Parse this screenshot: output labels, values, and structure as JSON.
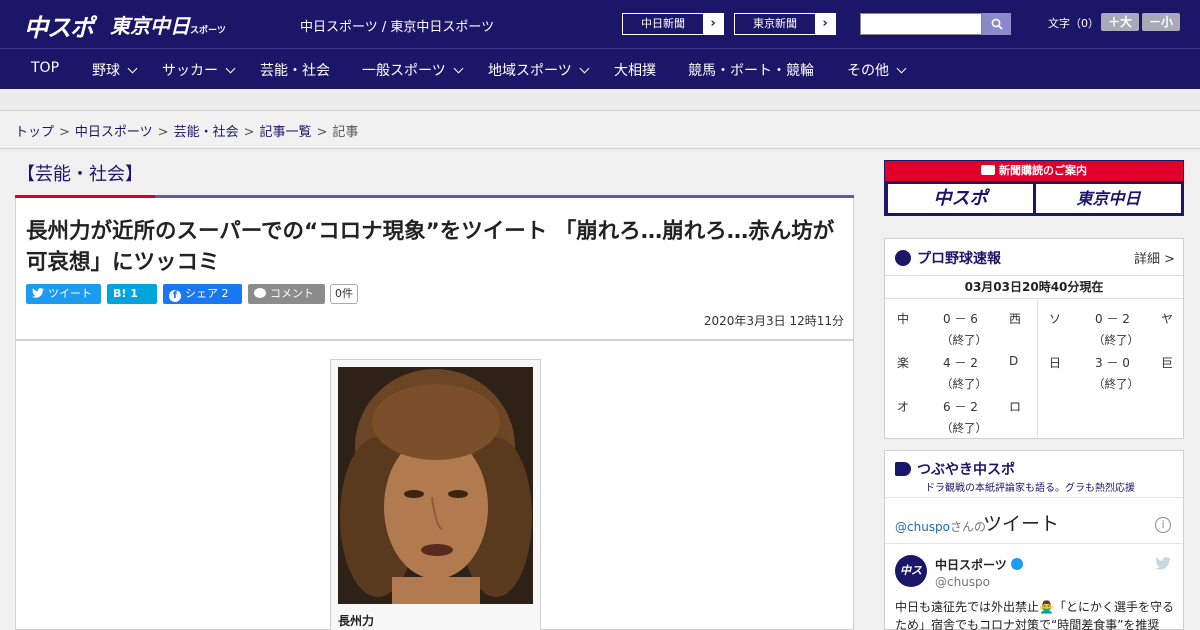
{
  "header": {
    "logo_chuspo": "中スポ",
    "logo_tokyo": "東京中日",
    "logo_tokyo_sub": "スポーツ",
    "site_names": "中日スポーツ / 東京中日スポーツ",
    "paper_buttons": [
      "中日新聞",
      "東京新聞"
    ],
    "search_placeholder": "",
    "font_size_label": "文字（0）",
    "font_plus": "＋大",
    "font_minus": "－小"
  },
  "nav": {
    "items": [
      "TOP",
      "野球",
      "サッカー",
      "芸能・社会",
      "一般スポーツ",
      "地域スポーツ",
      "大相撲",
      "競馬・ボート・競輪",
      "その他"
    ]
  },
  "breadcrumb": {
    "items": [
      "トップ",
      "中日スポーツ",
      "芸能・社会",
      "記事一覧"
    ],
    "current": "記事",
    "sep": ">"
  },
  "article": {
    "section": "【芸能・社会】",
    "title": "長州力が近所のスーパーでの“コロナ現象”をツイート 「崩れろ…崩れろ…赤ん坊が可哀想」にツッコミ",
    "share": {
      "tweet": "ツイート",
      "hatebu_label": "B!",
      "hatebu_count": "1",
      "facebook_label": "シェア",
      "facebook_count": "2",
      "comment": "コメント",
      "comment_count": "0件"
    },
    "date": "2020年3月3日 12時11分",
    "photo_caption": "長州力"
  },
  "sidebar": {
    "subscribe": {
      "header": "新聞購読のご案内",
      "btn1": "中スポ",
      "btn2": "東京中日"
    },
    "baseball": {
      "title": "プロ野球速報",
      "detail": "詳細 >",
      "updated": "03月03日20時40分現在",
      "games": [
        {
          "home": "中",
          "score": "0 － 6",
          "away": "西",
          "status": "（終了）"
        },
        {
          "home": "ソ",
          "score": "0 － 2",
          "away": "ヤ",
          "status": "（終了）"
        },
        {
          "home": "楽",
          "score": "4 － 2",
          "away": "D",
          "status": "（終了）"
        },
        {
          "home": "日",
          "score": "3 － 0",
          "away": "巨",
          "status": "（終了）"
        },
        {
          "home": "オ",
          "score": "6 － 2",
          "away": "ロ",
          "status": "（終了）"
        }
      ]
    },
    "twitter": {
      "title": "つぶやき中スポ",
      "subtitle": "ドラ観戦の本紙評論家も語る。グラも熱烈応援",
      "handle": "@chuspo",
      "handle_suffix": "さんの",
      "heading": "ツイート",
      "account_name": "中日スポーツ",
      "screen_name": "@chuspo",
      "avatar_text": "中スポ",
      "tweet_text": "中日も遠征先では外出禁止🙅‍♂️「とにかく選手を守るため」宿舎でもコロナ対策で“時間差食事”を推奨"
    }
  },
  "colors": {
    "navy": "#1c1669",
    "red": "#d6002a",
    "twitter": "#1d9bf0",
    "facebook": "#1877f2",
    "hatebu": "#00a4de"
  }
}
